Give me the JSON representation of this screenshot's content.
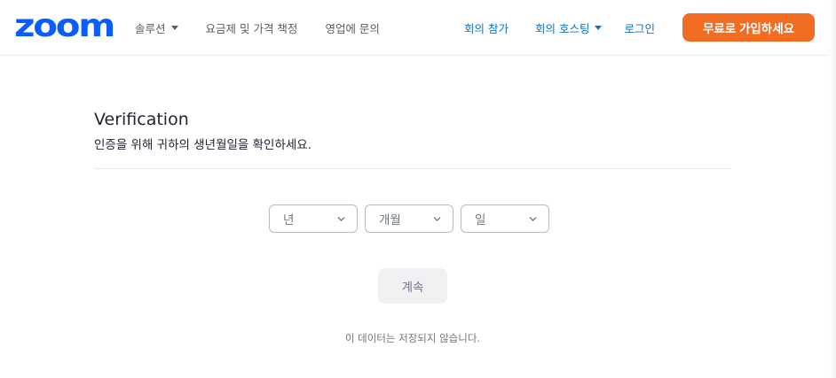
{
  "header": {
    "logo_text": "zoom",
    "nav_left": [
      {
        "label": "솔루션",
        "has_caret": true
      },
      {
        "label": "요금제 및 가격 책정",
        "has_caret": false
      },
      {
        "label": "영업에 문의",
        "has_caret": false
      }
    ],
    "nav_right": {
      "join_label": "회의 참가",
      "host_label": "회의 호스팅",
      "signin_label": "로그인",
      "signup_label": "무료로 가입하세요"
    }
  },
  "main": {
    "title": "Verification",
    "subtitle": "인증을 위해 귀하의 생년월일을 확인하세요.",
    "selects": {
      "year_placeholder": "년",
      "month_placeholder": "개월",
      "day_placeholder": "일"
    },
    "continue_label": "계속",
    "note": "이 데이터는 저장되지 않습니다."
  },
  "colors": {
    "brand_blue": "#0b5cff",
    "link_blue": "#0e72c4",
    "accent_orange": "#f26d21",
    "text_dark": "#232333",
    "text_muted": "#6e7680"
  },
  "icons": {
    "nav_caret": "caret-down-icon",
    "select_chevron": "chevron-down-icon"
  }
}
